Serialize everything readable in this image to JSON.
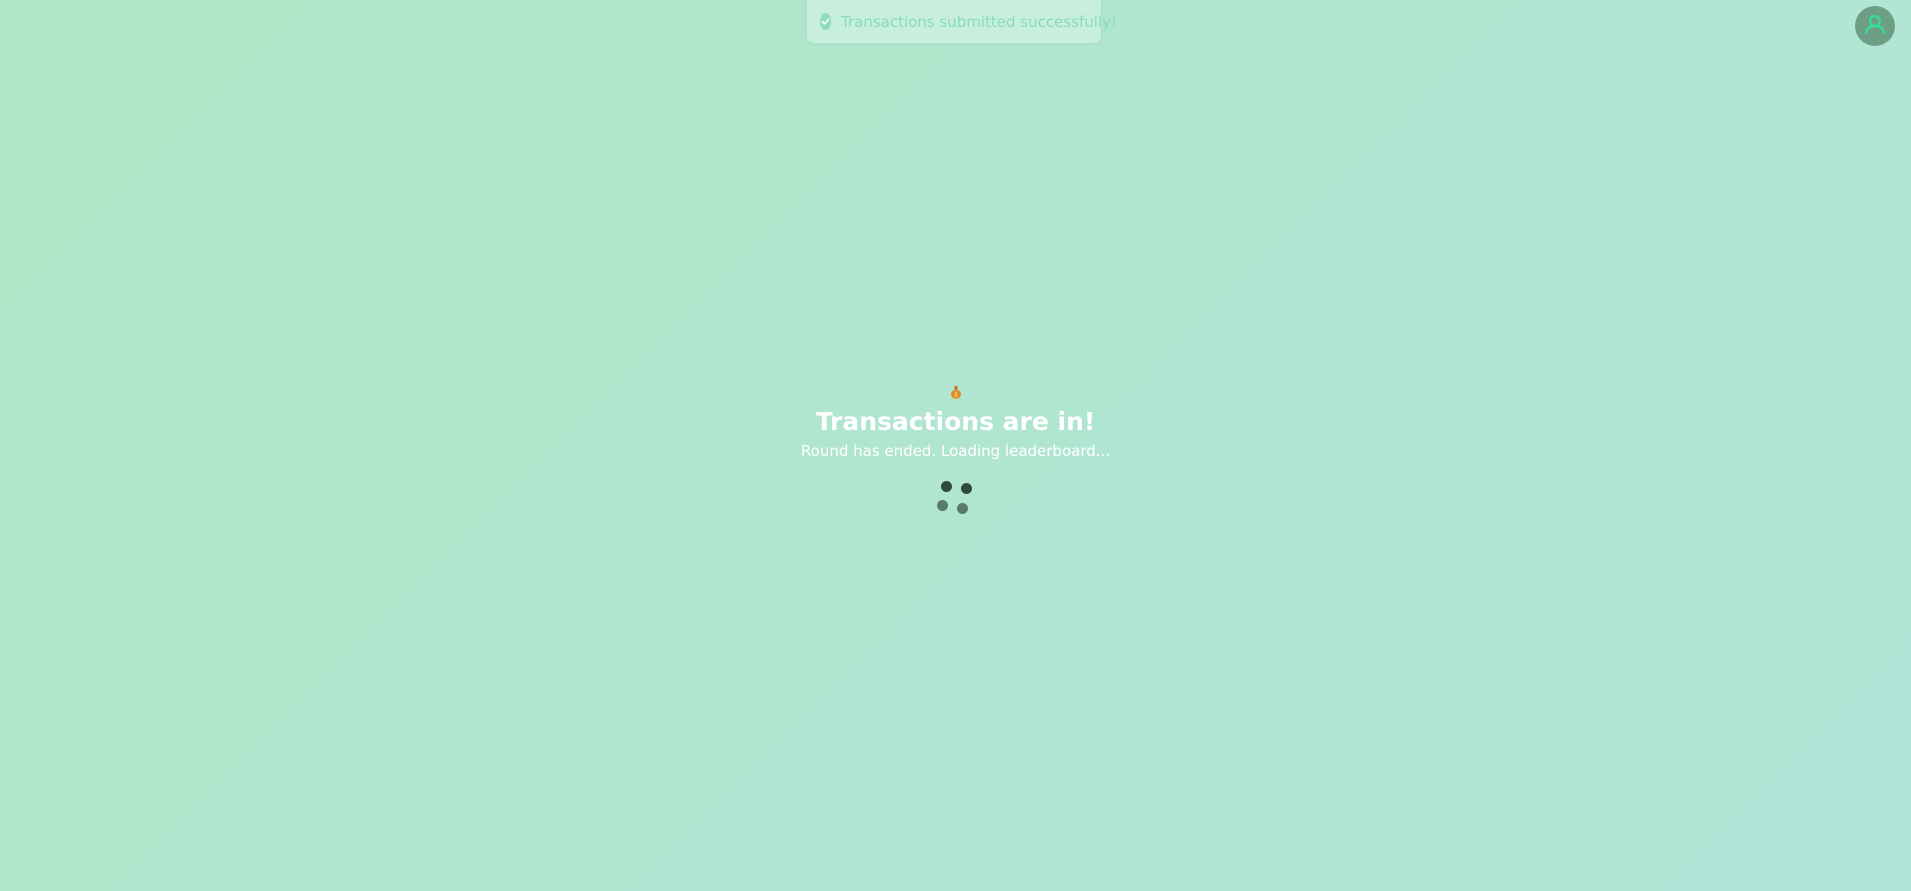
{
  "toast": {
    "message": "Transactions submitted successfully!",
    "icon": "check-circle-icon",
    "color": "#86dcbb"
  },
  "header": {
    "avatar_icon": "user-icon"
  },
  "status": {
    "icon": "money-bag-icon",
    "title": "Transactions are in!",
    "subtitle": "Round has ended. Loading leaderboard..."
  },
  "spinner": {
    "icon": "loading-dots-icon"
  },
  "colors": {
    "background": "#b0e6cc",
    "avatar": "#6e9e86",
    "avatar_glyph": "#2ee19a",
    "text": "#ffffff",
    "spinner_dark": "#2f4a3c",
    "spinner_light": "#5b7a69"
  }
}
